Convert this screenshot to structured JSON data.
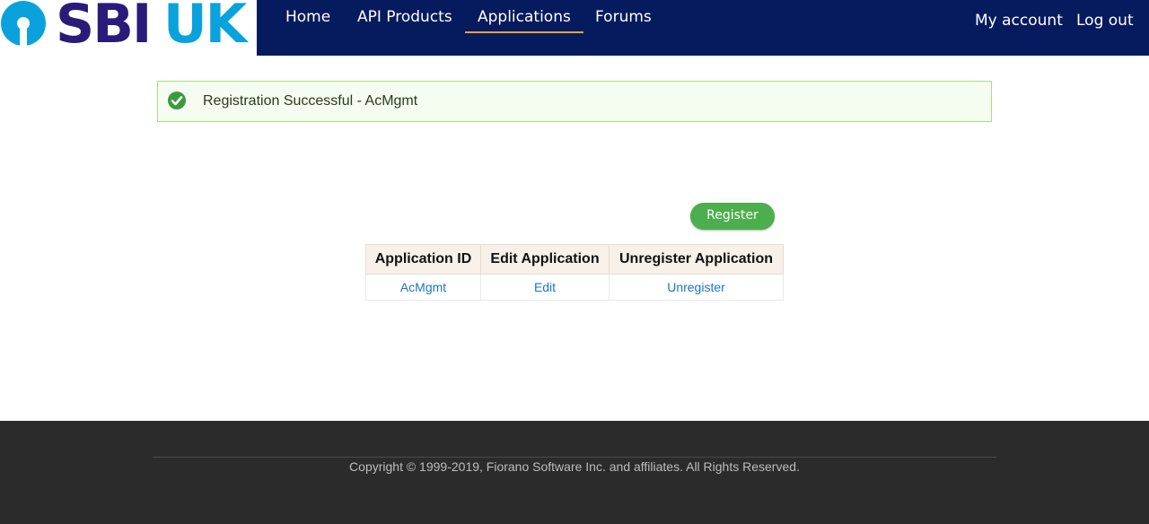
{
  "header": {
    "logo": {
      "brand": "SBI",
      "region": "UK"
    },
    "nav": [
      {
        "label": "Home"
      },
      {
        "label": "API Products"
      },
      {
        "label": "Applications",
        "active": true
      },
      {
        "label": "Forums"
      }
    ],
    "account": {
      "my_account": "My account",
      "logout": "Log out"
    }
  },
  "alert": {
    "message": "Registration Successful - AcMgmt",
    "icon": "check-circle-icon",
    "color": "#3c9a3c"
  },
  "register_button": "Register",
  "table": {
    "headers": [
      "Application ID",
      "Edit Application",
      "Unregister Application"
    ],
    "rows": [
      {
        "app_id": "AcMgmt",
        "edit": "Edit",
        "unregister": "Unregister"
      }
    ]
  },
  "footer": {
    "copyright": "Copyright © 1999-2019, Fiorano Software Inc. and affiliates. All Rights Reserved."
  },
  "colors": {
    "header_bg": "#061a5e",
    "accent": "#e8a33a",
    "button": "#4cae4c",
    "link": "#1e73c9",
    "footer_bg": "#2b2b2b"
  }
}
